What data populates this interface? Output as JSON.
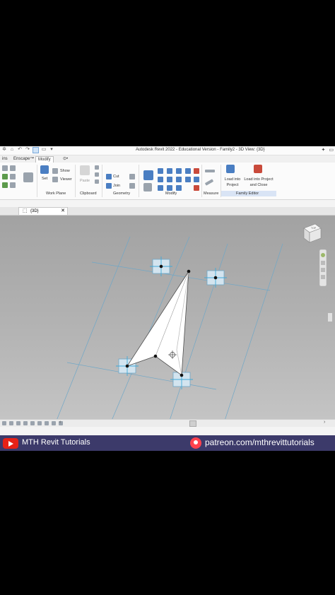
{
  "titlebar": {
    "title": "Autodesk Revit 2022 - Educational Version - Family2 - 3D View: {3D}"
  },
  "tabs": [
    {
      "label": "ins"
    },
    {
      "label": "Enscape™"
    },
    {
      "label": "Modify"
    },
    {
      "label": "⊙•"
    }
  ],
  "ribbon": {
    "work_plane": {
      "show": "Show",
      "set": "Set",
      "viewer": "Viewer",
      "panel": "Work Plane"
    },
    "clipboard": {
      "paste": "Paste",
      "panel": "Clipboard"
    },
    "geometry": {
      "cut": "Cut",
      "join": "Join",
      "panel": "Geometry"
    },
    "modify": {
      "panel": "Modify"
    },
    "measure": {
      "panel": "Measure"
    },
    "family_editor": {
      "load_into_project": "Load into Project",
      "load_into_project_close": "Load into Project and Close",
      "panel": "Family Editor"
    }
  },
  "view_tab": {
    "label": "{3D}"
  },
  "viewcube": {
    "face": "TOP"
  },
  "banner": {
    "left": "MTH Revit Tutorials",
    "right": "patreon.com/mthrevittutorials"
  },
  "colors": {
    "accent": "#4a7ec2",
    "banner_bg": "#3c3a6a",
    "youtube": "#e62117",
    "patreon": "#ff424d",
    "selection": "#3fa9d8"
  }
}
